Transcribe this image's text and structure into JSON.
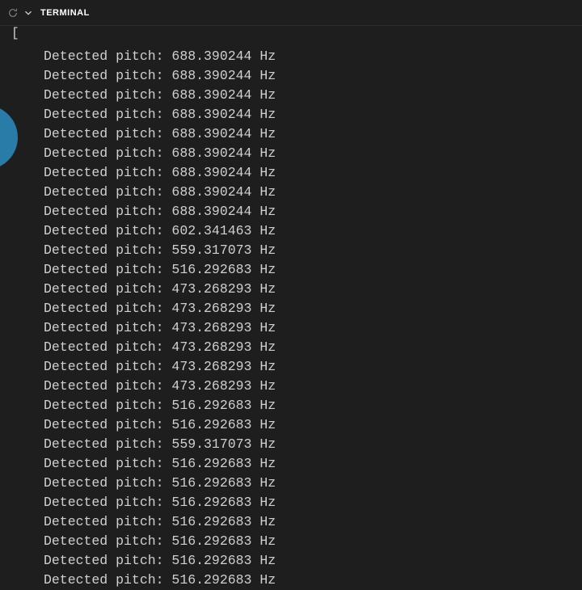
{
  "panel": {
    "title": "TERMINAL"
  },
  "gutter": {
    "bracket": "["
  },
  "output": {
    "prefix": "Detected pitch: ",
    "suffix": " Hz",
    "values": [
      "688.390244",
      "688.390244",
      "688.390244",
      "688.390244",
      "688.390244",
      "688.390244",
      "688.390244",
      "688.390244",
      "688.390244",
      "602.341463",
      "559.317073",
      "516.292683",
      "473.268293",
      "473.268293",
      "473.268293",
      "473.268293",
      "473.268293",
      "473.268293",
      "516.292683",
      "516.292683",
      "559.317073",
      "516.292683",
      "516.292683",
      "516.292683",
      "516.292683",
      "516.292683",
      "516.292683",
      "516.292683"
    ]
  }
}
